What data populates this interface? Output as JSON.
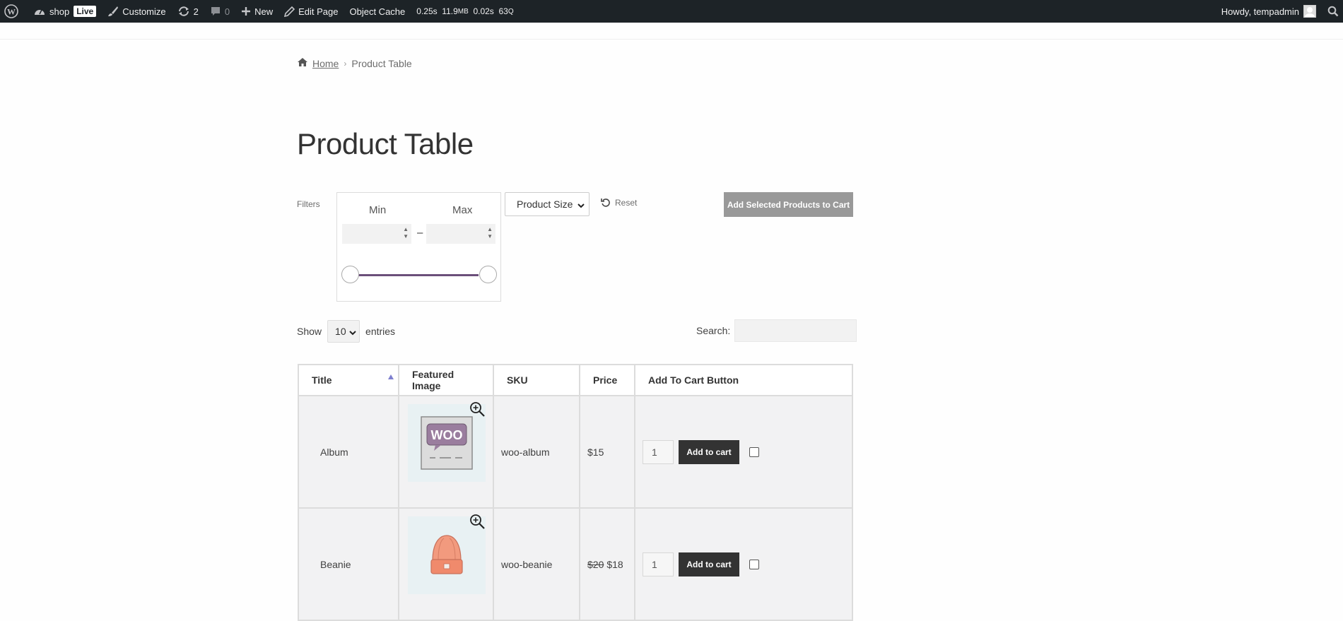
{
  "adminbar": {
    "site_name": "shop",
    "live_badge": "Live",
    "customize": "Customize",
    "updates_count": "2",
    "comments_count": "0",
    "new_label": "New",
    "edit_page": "Edit Page",
    "object_cache": "Object Cache",
    "qm_time": "0.25s",
    "qm_mem": "11.9",
    "qm_mem_unit": "MB",
    "qm_db": "0.02s",
    "qm_queries": "63",
    "qm_queries_unit": "Q",
    "howdy": "Howdy, tempadmin"
  },
  "breadcrumb": {
    "home": "Home",
    "current": "Product Table"
  },
  "page_title": "Product Table",
  "filters": {
    "label": "Filters",
    "min_label": "Min",
    "max_label": "Max",
    "dash": "–",
    "size_select": "Product Size",
    "reset": "Reset",
    "add_selected": "Add Selected Products to Cart"
  },
  "table_controls": {
    "show": "Show",
    "entries_value": "10",
    "entries": "entries",
    "search_label": "Search:"
  },
  "columns": {
    "title": "Title",
    "image": "Featured Image",
    "sku": "SKU",
    "price": "Price",
    "cart": "Add To Cart Button"
  },
  "rows": [
    {
      "title": "Album",
      "sku": "woo-album",
      "old_price": "",
      "price": "$15",
      "qty": "1",
      "add_label": "Add to cart",
      "image_text": "WOO"
    },
    {
      "title": "Beanie",
      "sku": "woo-beanie",
      "old_price": "$20",
      "price": "$18",
      "qty": "1",
      "add_label": "Add to cart",
      "image_text": ""
    }
  ],
  "colors": {
    "adminbar_bg": "#1d2327",
    "slider": "#6b4f7a",
    "button_dark": "#333333",
    "button_disabled": "#999999"
  }
}
